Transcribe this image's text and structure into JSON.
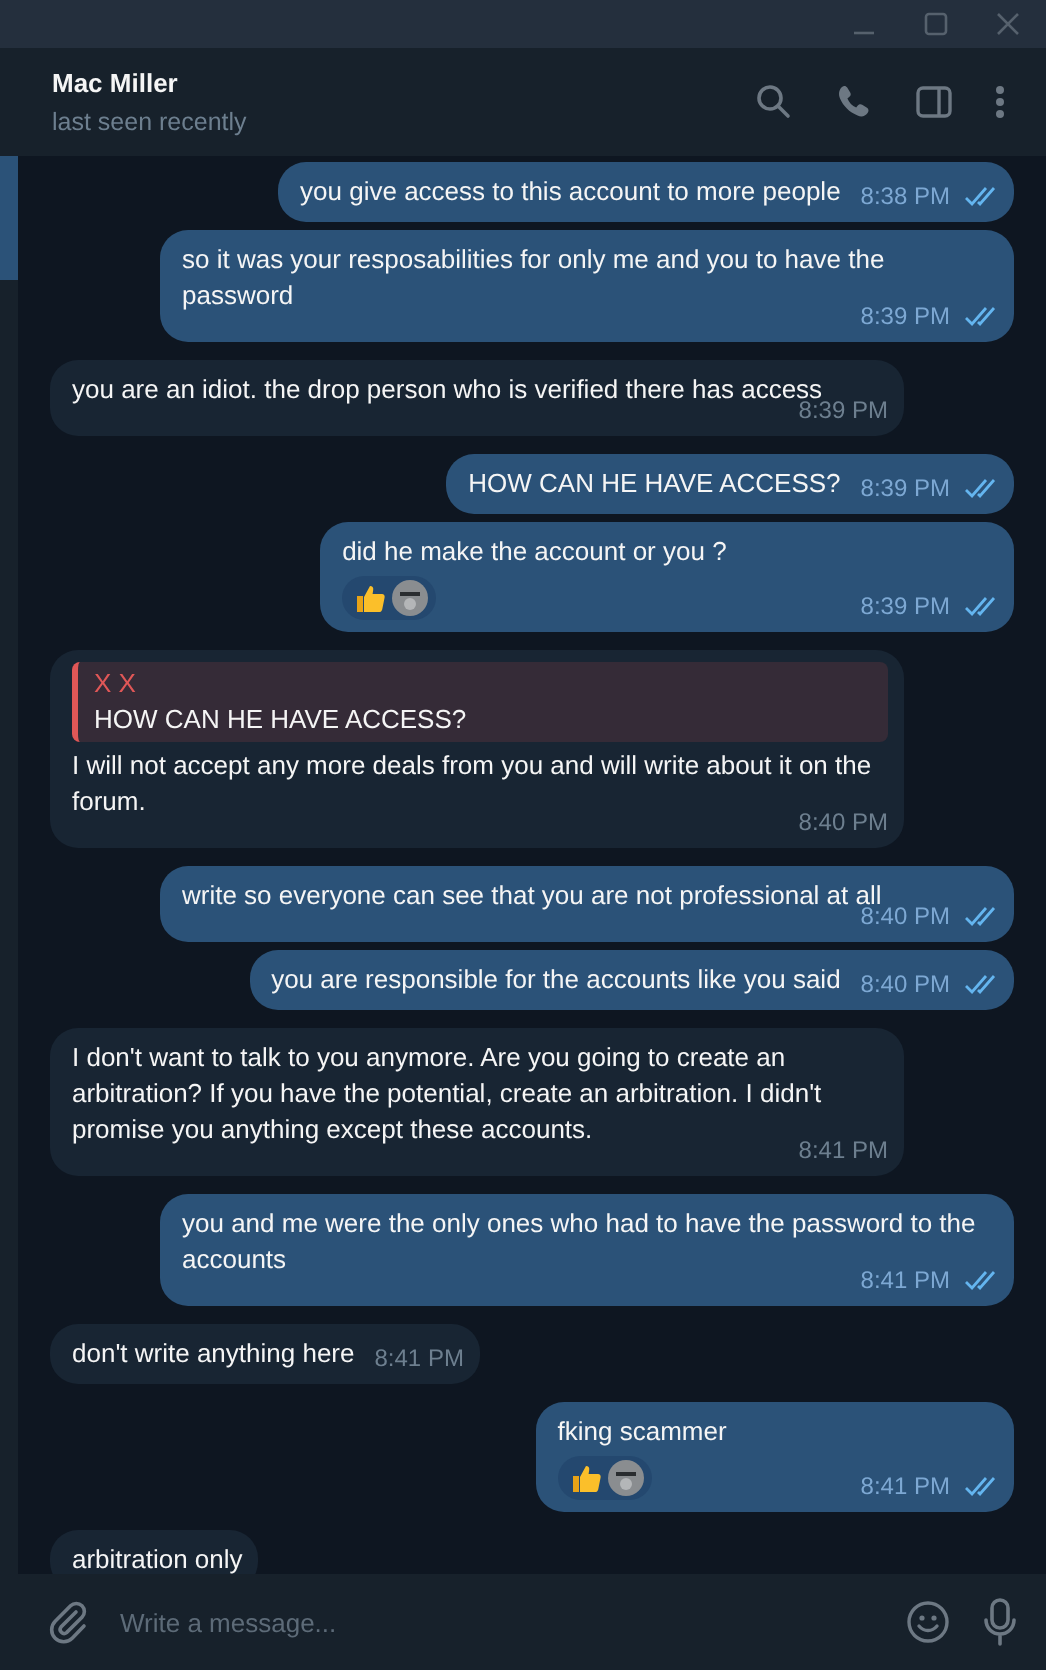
{
  "header": {
    "name": "Mac Miller",
    "status": "last seen recently"
  },
  "messages": [
    {
      "outgoing": true,
      "text": "you give access to this account to more people",
      "time": "8:38 PM",
      "read": true
    },
    {
      "outgoing": true,
      "text": "so it was your resposabilities for only me and you to have the password",
      "time": "8:39 PM",
      "read": true
    },
    {
      "outgoing": false,
      "text": "you are an idiot. the drop person who is verified there has access",
      "time": "8:39 PM"
    },
    {
      "outgoing": true,
      "text": "HOW CAN HE HAVE ACCESS?",
      "time": "8:39 PM",
      "read": true
    },
    {
      "outgoing": true,
      "text": "did he make the account or you ?",
      "time": "8:39 PM",
      "read": true,
      "reactions": [
        {
          "kind": "thumbs_up"
        },
        {
          "kind": "avatar"
        }
      ]
    },
    {
      "outgoing": false,
      "reply": {
        "author": "X X",
        "text": "HOW CAN HE HAVE ACCESS?"
      },
      "text": "I will not accept any more deals from you and will write about it on the forum.",
      "time": "8:40 PM"
    },
    {
      "outgoing": true,
      "text": "write so everyone can see that you are not professional at all",
      "time": "8:40 PM",
      "read": true
    },
    {
      "outgoing": true,
      "text": "you are responsible for the accounts like you said",
      "time": "8:40 PM",
      "read": true
    },
    {
      "outgoing": false,
      "text": "I don't want to talk to you anymore. Are you going to create an arbitration? If you have the potential, create an arbitration. I didn't promise you anything except these accounts.",
      "time": "8:41 PM"
    },
    {
      "outgoing": true,
      "text": "you and me were the only ones who had to have the password to the accounts",
      "time": "8:41 PM",
      "read": true
    },
    {
      "outgoing": false,
      "text": "don't write anything here",
      "time": "8:41 PM"
    },
    {
      "outgoing": true,
      "text": "fking scammer",
      "time": "8:41 PM",
      "read": true,
      "reactions": [
        {
          "kind": "thumbs_up"
        },
        {
          "kind": "avatar"
        }
      ]
    },
    {
      "outgoing": false,
      "text": "arbitration only"
    }
  ],
  "composer": {
    "placeholder": "Write a message..."
  }
}
